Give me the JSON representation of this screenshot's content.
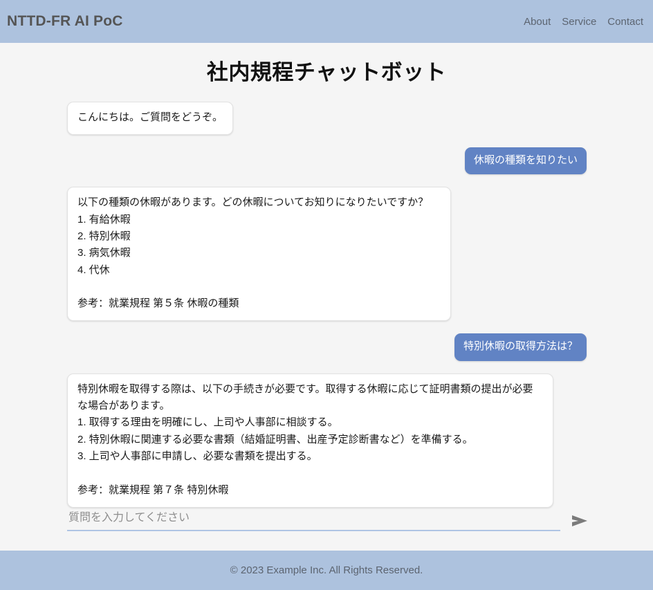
{
  "header": {
    "brand": "NTTD-FR AI PoC",
    "nav": [
      {
        "label": "About"
      },
      {
        "label": "Service"
      },
      {
        "label": "Contact"
      }
    ]
  },
  "main": {
    "title": "社内規程チャットボット",
    "messages": [
      {
        "role": "bot",
        "text": "こんにちは。ご質問をどうぞ。"
      },
      {
        "role": "user",
        "text": "休暇の種類を知りたい"
      },
      {
        "role": "bot",
        "text": "以下の種類の休暇があります。どの休暇についてお知りになりたいですか？\n1. 有給休暇\n2. 特別休暇\n3. 病気休暇\n4. 代休\n\n参考：就業規程 第５条 休暇の種類"
      },
      {
        "role": "user",
        "text": "特別休暇の取得方法は？"
      },
      {
        "role": "bot",
        "text": "特別休暇を取得する際は、以下の手続きが必要です。取得する休暇に応じて証明書類の提出が必要な場合があります。\n1. 取得する理由を明確にし、上司や人事部に相談する。\n2. 特別休暇に関連する必要な書類（結婚証明書、出産予定診断書など）を準備する。\n3. 上司や人事部に申請し、必要な書類を提出する。\n\n参考：就業規程 第７条 特別休暇"
      }
    ]
  },
  "composer": {
    "input_value": "",
    "placeholder": "質問を入力してください",
    "send_icon": "send-arrow-icon",
    "send_label": "➤"
  },
  "footer": {
    "copyright": "© 2023 Example Inc. All Rights Reserved."
  },
  "colors": {
    "header_bg": "#adc2de",
    "footer_bg": "#adc2de",
    "page_bg": "#f5f5f5",
    "user_bubble": "#6183c4",
    "bot_bubble": "#ffffff",
    "input_underline": "#aec4e4",
    "send_icon": "#7b7b7b"
  }
}
